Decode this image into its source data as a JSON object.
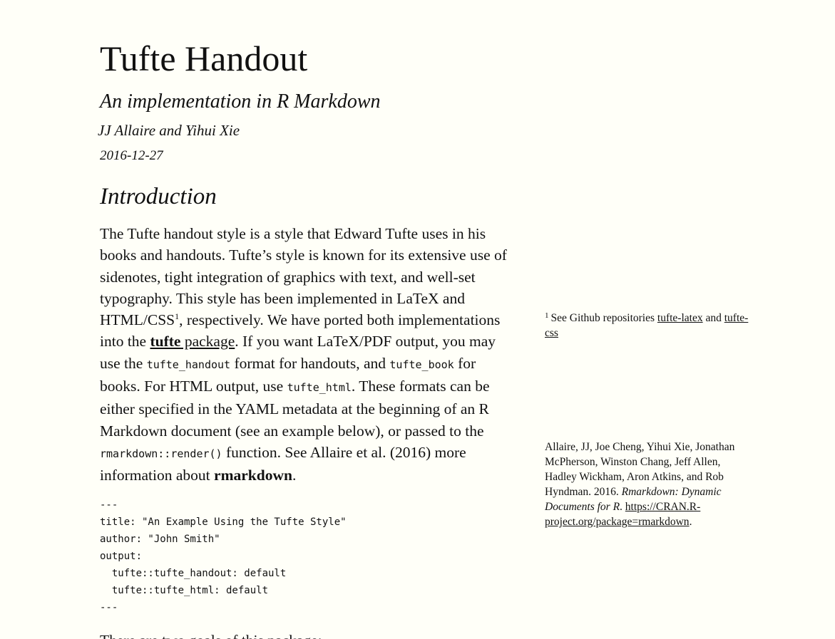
{
  "document": {
    "title": "Tufte Handout",
    "subtitle": "An implementation in R Markdown",
    "author": "JJ Allaire and Yihui Xie",
    "date": "2016-12-27"
  },
  "section": {
    "heading": "Introduction"
  },
  "paragraph": {
    "t1": "The Tufte handout style is a style that Edward Tufte uses in his books and handouts. Tufte’s style is known for its extensive use of sidenotes, tight integration of graphics with text, and well-set typography. This style has been implemented in LaTeX and HTML/CSS",
    "footnote_ref": "1",
    "t2": ", respectively. We have ported both implementations into the ",
    "pkg_bold": "tufte",
    "pkg_rest": " package",
    "t3": ". If you want LaTeX/PDF output, you may use the ",
    "code1": "tufte_handout",
    "t4": " format for handouts, and ",
    "code2": "tufte_book",
    "t5": " for books. For HTML output, use ",
    "code3": "tufte_html",
    "t6": ". These formats can be either specified in the YAML metadata at the beginning of an R Markdown document (see an example below), or passed to the ",
    "code4": "rmarkdown::render()",
    "t7": " function. See Allaire et al. (2016) more information about ",
    "rmarkdown_bold": "rmarkdown",
    "t8": "."
  },
  "code_block": "---\ntitle: \"An Example Using the Tufte Style\"\nauthor: \"John Smith\"\noutput:\n  tufte::tufte_handout: default\n  tufte::tufte_html: default\n---",
  "tail_text": "There are two goals of this package:",
  "sidenote1": {
    "number": "1",
    "text": "See Github repositories ",
    "link1": "tufte-latex",
    "and": " and ",
    "link2": "tufte-css"
  },
  "reference": {
    "authors": "Allaire, JJ, Joe Cheng, Yihui Xie, Jonathan McPherson, Winston Chang, Jeff Allen, Hadley Wickham, Aron Atkins, and Rob Hyndman. 2016. ",
    "book_title": "Rmarkdown: Dynamic Documents for R",
    "sep": ". ",
    "url": "https://CRAN.R-project.org/package=rmarkdown",
    "end": "."
  }
}
